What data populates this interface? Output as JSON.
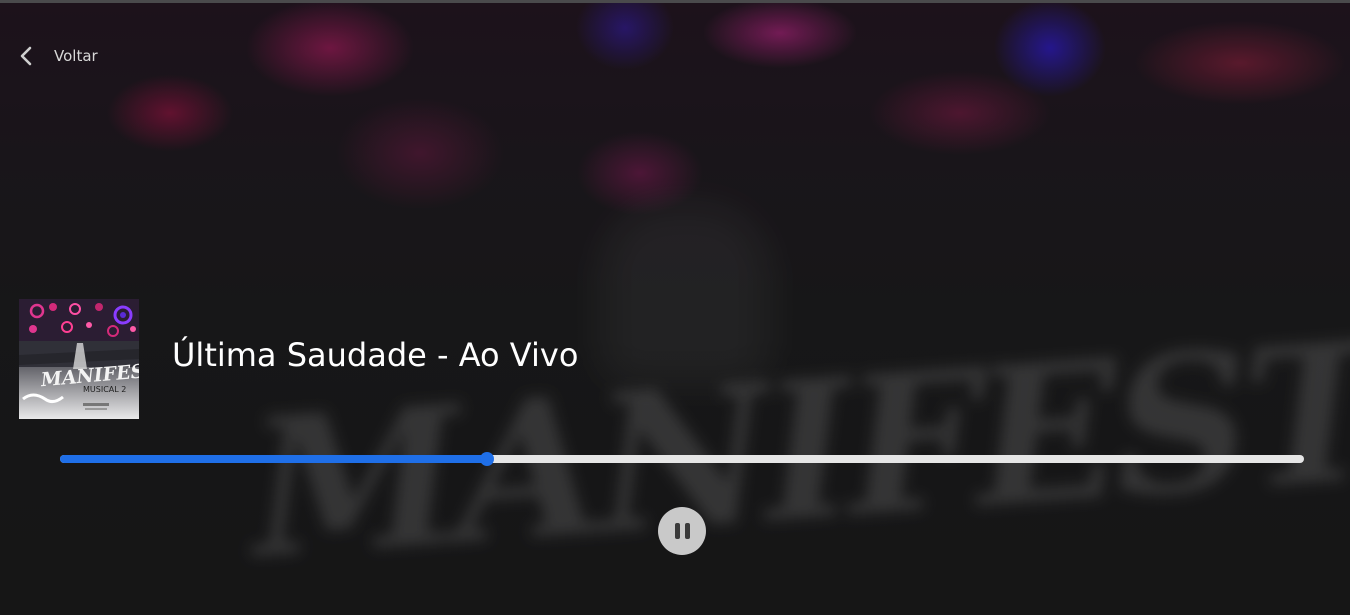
{
  "back": {
    "label": "Voltar"
  },
  "track": {
    "title": "Última Saudade - Ao Vivo",
    "progress_fraction": 0.343
  },
  "cover": {
    "logo_text": "MANIFESTO",
    "subtitle_text": "MUSICAL 2"
  },
  "background": {
    "logo_text": "MANIFESTO"
  },
  "colors": {
    "accent": "#1f6fe8",
    "track": "#e6e6e6",
    "button": "#c9c9c9"
  },
  "icons": {
    "back": "chevron-left-icon",
    "playback": "pause-icon"
  }
}
